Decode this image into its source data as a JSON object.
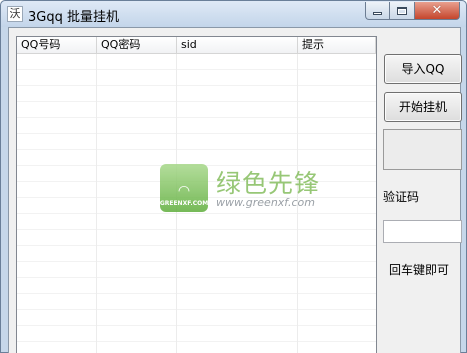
{
  "window": {
    "title": "3Gqq 批量挂机",
    "icon_text": "沃"
  },
  "list": {
    "columns": [
      "QQ号码",
      "QQ密码",
      "sid",
      "提示"
    ],
    "rows": []
  },
  "watermark": {
    "logo_text": "GREENXF.COM",
    "name": "绿色先锋",
    "url": "www.greenxf.com"
  },
  "actions": {
    "import_label": "导入QQ",
    "start_label": "开始挂机"
  },
  "captcha": {
    "label": "验证码",
    "input_value": "",
    "enter_hint": "回车键即可"
  },
  "colors": {
    "close_button": "#c5452c",
    "watermark_green": "#8cc168",
    "titlebar": "#c3d5ea"
  }
}
